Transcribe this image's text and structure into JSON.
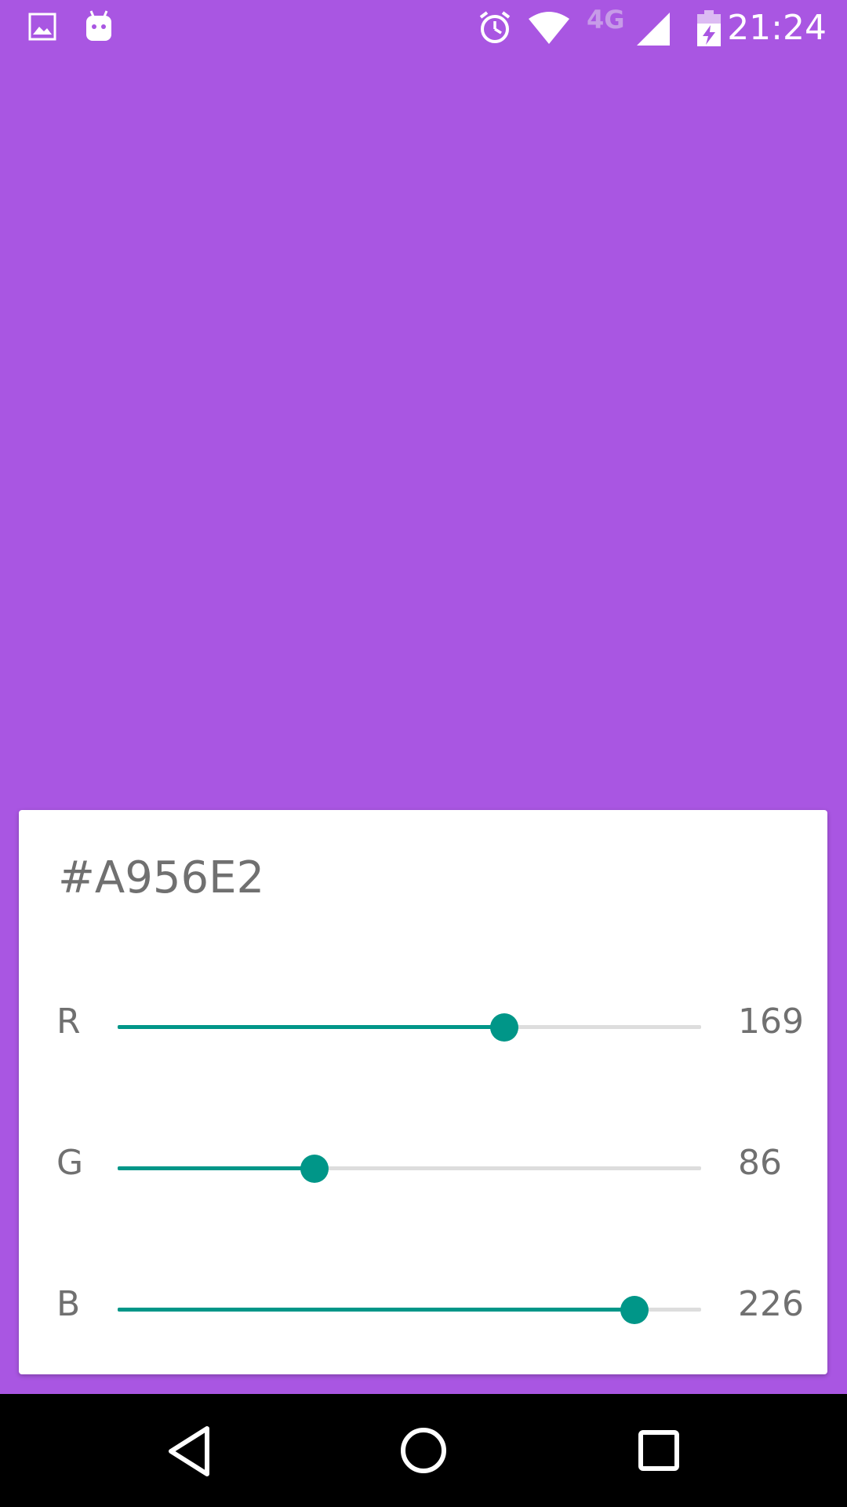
{
  "status_bar": {
    "time": "21:24",
    "network_label": "4G",
    "left_icons": [
      "image-icon",
      "android-debug-icon"
    ],
    "right_icons": [
      "alarm-icon",
      "wifi-icon",
      "signal-icon",
      "battery-charging-icon"
    ]
  },
  "colors": {
    "background": "#A956E2",
    "accent": "#009688",
    "track": "#dddddd"
  },
  "picker": {
    "hex": "#A956E2",
    "sliders": [
      {
        "label": "R",
        "value": "169",
        "max": 255
      },
      {
        "label": "G",
        "value": "86",
        "max": 255
      },
      {
        "label": "B",
        "value": "226",
        "max": 255
      }
    ]
  },
  "nav_bar": {
    "buttons": [
      "back-icon",
      "home-icon",
      "recents-icon"
    ]
  }
}
